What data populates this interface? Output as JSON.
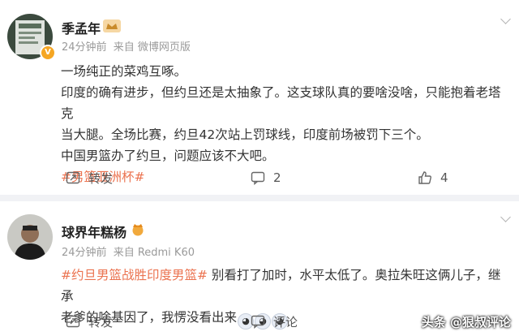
{
  "post1": {
    "author": "季孟年",
    "time": "24分钟前",
    "source": "来自 微博网页版",
    "lines": [
      "一场纯正的菜鸡互啄。",
      "印度的确有进步，但约旦还是太抽象了。这支球队真的要啥没啥，只能抱着老塔克",
      "当大腿。全场比赛，约旦42次站上罚球线，印度前场被罚下三个。",
      "中国男篮办了约旦，问题应该不大吧。"
    ],
    "tag": "#男篮亚洲杯#",
    "repost_label": "转发",
    "comment_count": "2",
    "like_count": "4"
  },
  "post2": {
    "author": "球界年糕杨",
    "time": "24分钟前",
    "source": "来自 Redmi K60",
    "tag": "#约旦男篮战胜印度男篮#",
    "text_1": " 别看打了加时，水平太低了。奥拉朱旺这俩儿子，继承",
    "text_2": "老爹的啥基因了，我愣没看出来",
    "comment_label": "评论"
  },
  "watermark": "头条 @狠叔评论",
  "icons": [
    "verified-badge-icon",
    "more-chevron-icon",
    "repost-icon",
    "comment-icon",
    "like-icon",
    "face-emoji-icon"
  ],
  "colors": {
    "tag": "#eb7350",
    "badge": "#f5a623",
    "meta": "#9a9a9a"
  }
}
